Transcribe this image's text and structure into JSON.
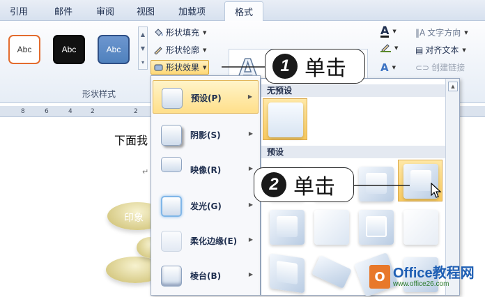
{
  "tabs": [
    "引用",
    "邮件",
    "审阅",
    "视图",
    "加载项",
    "格式"
  ],
  "shape_styles": {
    "presets": [
      {
        "label": "Abc",
        "border": "#e36c2e",
        "fill": "#ffffff",
        "text": "#333333"
      },
      {
        "label": "Abc",
        "border": "#000000",
        "fill": "#111111",
        "text": "#ffffff"
      },
      {
        "label": "Abc",
        "border": "#2e4f86",
        "fill": "#4f81bd",
        "text": "#ffffff"
      }
    ],
    "group_label": "形状样式",
    "commands": {
      "fill": "形状填充",
      "outline": "形状轮廓",
      "effects": "形状效果"
    }
  },
  "text_group": {
    "direction": "文字方向",
    "align": "对齐文本",
    "link": "创建链接"
  },
  "ruler": [
    "8",
    "6",
    "4",
    "2",
    "2"
  ],
  "document": {
    "line1": "下面我",
    "para_mark": "↵",
    "blob_label": "印象"
  },
  "effects_menu": [
    {
      "label": "预设(P)",
      "selected": true
    },
    {
      "label": "阴影(S)",
      "selected": false
    },
    {
      "label": "映像(R)",
      "selected": false
    },
    {
      "label": "发光(G)",
      "selected": false
    },
    {
      "label": "柔化边缘(E)",
      "selected": false
    },
    {
      "label": "棱台(B)",
      "selected": false
    }
  ],
  "submenu": {
    "no_preset_header": "无预设",
    "preset_header": "预设"
  },
  "callouts": [
    {
      "num": "1",
      "text": "单击"
    },
    {
      "num": "2",
      "text": "单击"
    }
  ],
  "watermark": {
    "title": "Office教程网",
    "url": "www.office26.com",
    "logo": "O"
  }
}
